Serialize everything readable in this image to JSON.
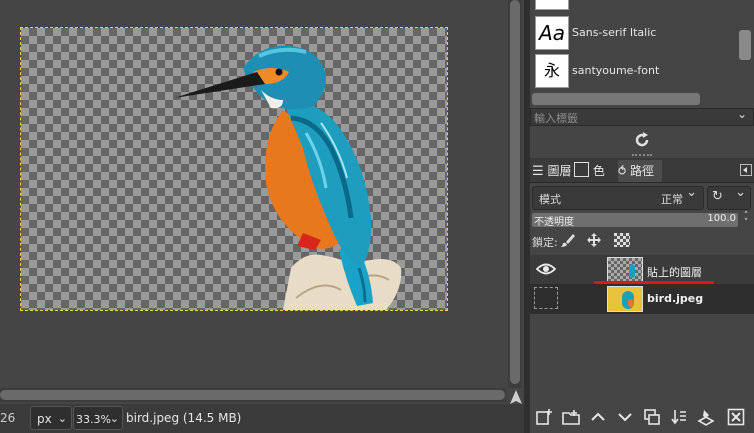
{
  "statusbar": {
    "coord": "26",
    "unit": "px",
    "zoom": "33.3%",
    "file_info": "bird.jpeg (14.5 MB)"
  },
  "fonts": {
    "items": [
      {
        "preview": "Aa",
        "name": "Sans-serif Italic"
      },
      {
        "preview": "永",
        "name": "santyoume-font"
      }
    ],
    "tag_placeholder": "輸入標籤"
  },
  "dock": {
    "tabs": [
      {
        "label": "圖層"
      },
      {
        "label": "色版"
      },
      {
        "label": "路徑"
      }
    ]
  },
  "layers": {
    "mode_label": "模式",
    "mode_value": "正常",
    "opacity_label": "不透明度",
    "opacity_value": "100.0",
    "lock_label": "鎖定:",
    "items": [
      {
        "name": "貼上的圖層",
        "visible": true,
        "selected": true
      },
      {
        "name": "bird.jpeg",
        "visible": false,
        "selected": false
      }
    ]
  },
  "colors": {
    "accent_red": "#d41c1c",
    "selection_row": "#3b3b3b",
    "selection_outline": "#e8d44a"
  }
}
